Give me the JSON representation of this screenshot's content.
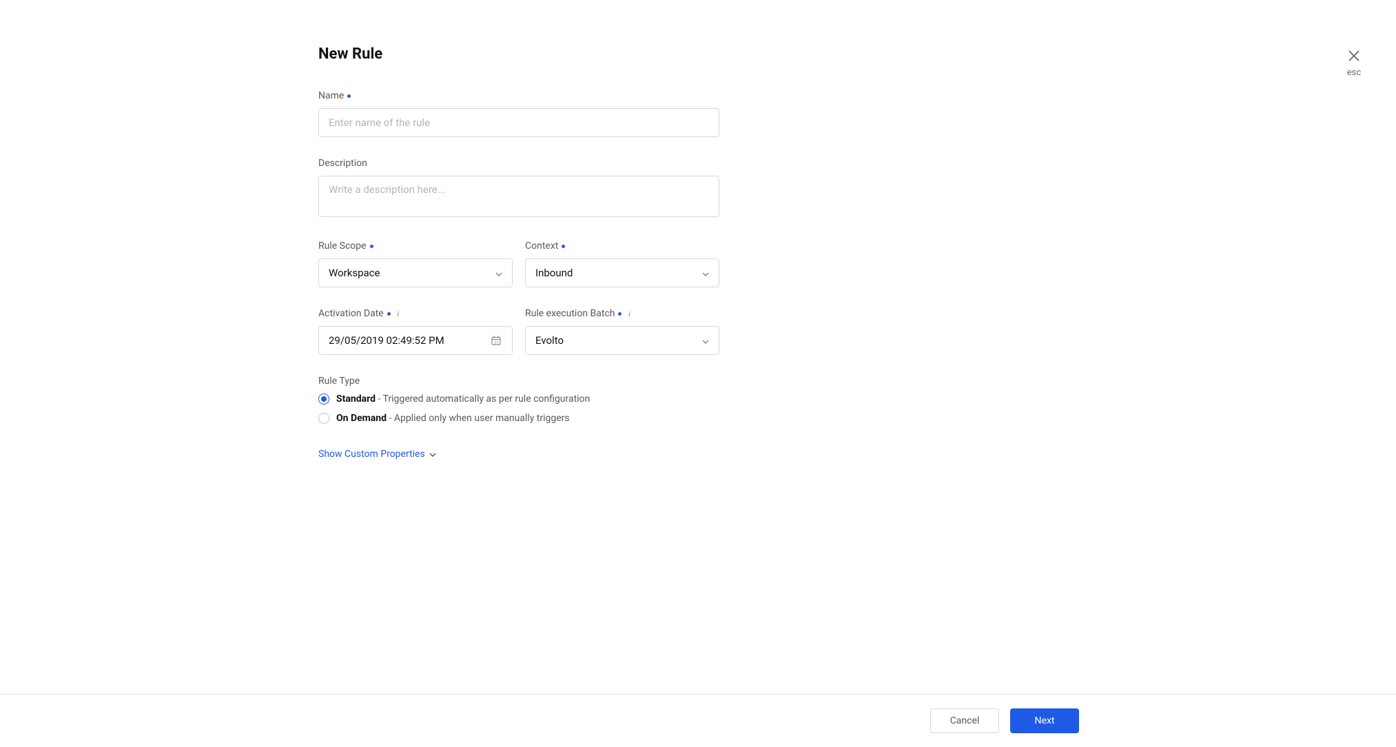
{
  "modal": {
    "title": "New Rule",
    "close_hint": "esc"
  },
  "fields": {
    "name": {
      "label": "Name",
      "placeholder": "Enter name of the rule",
      "value": ""
    },
    "description": {
      "label": "Description",
      "placeholder": "Write a description here...",
      "value": ""
    },
    "rule_scope": {
      "label": "Rule Scope",
      "value": "Workspace"
    },
    "context": {
      "label": "Context",
      "value": "Inbound"
    },
    "activation_date": {
      "label": "Activation Date",
      "value": "29/05/2019 02:49:52 PM"
    },
    "batch": {
      "label": "Rule execution Batch",
      "value": "Evolto"
    },
    "rule_type": {
      "label": "Rule Type",
      "options": [
        {
          "name": "Standard",
          "desc": "Triggered automatically as per rule configuration",
          "selected": true
        },
        {
          "name": "On Demand",
          "desc": "Applied only when user manually triggers",
          "selected": false
        }
      ]
    },
    "custom_props_link": "Show Custom Properties"
  },
  "footer": {
    "cancel": "Cancel",
    "next": "Next"
  },
  "sep": " - "
}
